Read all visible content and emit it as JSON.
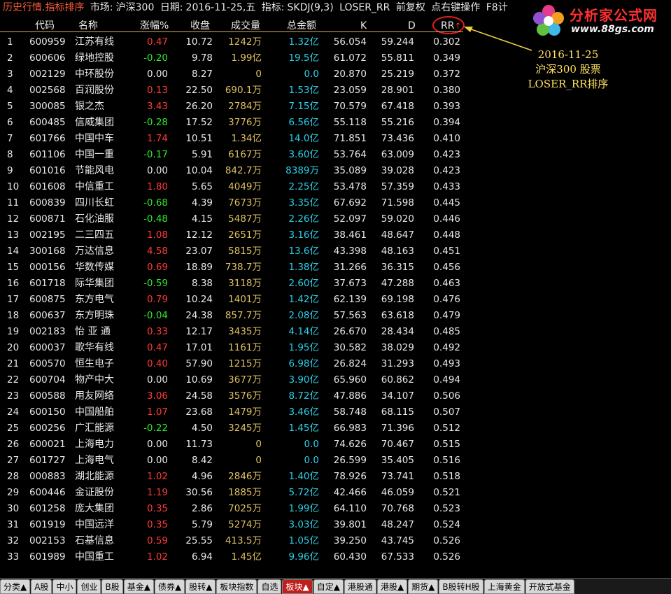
{
  "title": {
    "main": "历史行情.指标排序",
    "market_label": "市场:",
    "market": "沪深300",
    "date_label": "日期:",
    "date": "2016-11-25,五",
    "indicator_label": "指标:",
    "indicator": "SKDJ(9,3)",
    "sort_field": "LOSER_RR",
    "adjust": "前复权",
    "hint": "点右键操作",
    "f8": "F8计"
  },
  "logo": {
    "name": "分析家公式网",
    "url": "www.88gs.com"
  },
  "columns": {
    "code": "代码",
    "name": "名称",
    "pct": "涨幅%",
    "close": "收盘",
    "volume": "成交量",
    "amount": "总金额",
    "k": "K",
    "d": "D",
    "rr": "RR",
    "sort_arrow": "↑"
  },
  "annotation": {
    "line1": "2016-11-25",
    "line2": "沪深300 股票",
    "line3": "LOSER_RR排序"
  },
  "rows": [
    {
      "idx": "1",
      "code": "600959",
      "name": "江苏有线",
      "pct": "0.47",
      "dir": "up",
      "close": "10.72",
      "vol": "1242",
      "vol_u": "万",
      "amt": "1.32",
      "amt_u": "亿",
      "k": "56.054",
      "d": "59.244",
      "rr": "0.302"
    },
    {
      "idx": "2",
      "code": "600606",
      "name": "绿地控股",
      "pct": "-0.20",
      "dir": "down",
      "close": "9.78",
      "vol": "1.99",
      "vol_u": "亿",
      "amt": "19.5",
      "amt_u": "亿",
      "k": "61.072",
      "d": "55.811",
      "rr": "0.349"
    },
    {
      "idx": "3",
      "code": "002129",
      "name": "中环股份",
      "pct": "0.00",
      "dir": "flat",
      "close": "8.27",
      "vol": "0",
      "vol_u": "",
      "amt": "0.0",
      "amt_u": "",
      "k": "20.870",
      "d": "25.219",
      "rr": "0.372"
    },
    {
      "idx": "4",
      "code": "002568",
      "name": "百润股份",
      "pct": "0.13",
      "dir": "up",
      "close": "22.50",
      "vol": "690.1",
      "vol_u": "万",
      "amt": "1.53",
      "amt_u": "亿",
      "k": "23.059",
      "d": "28.901",
      "rr": "0.380"
    },
    {
      "idx": "5",
      "code": "300085",
      "name": "银之杰",
      "pct": "3.43",
      "dir": "up",
      "close": "26.20",
      "vol": "2784",
      "vol_u": "万",
      "amt": "7.15",
      "amt_u": "亿",
      "k": "70.579",
      "d": "67.418",
      "rr": "0.393"
    },
    {
      "idx": "6",
      "code": "600485",
      "name": "信威集团",
      "pct": "-0.28",
      "dir": "down",
      "close": "17.52",
      "vol": "3776",
      "vol_u": "万",
      "amt": "6.56",
      "amt_u": "亿",
      "k": "55.118",
      "d": "55.216",
      "rr": "0.394"
    },
    {
      "idx": "7",
      "code": "601766",
      "name": "中国中车",
      "pct": "1.74",
      "dir": "up",
      "close": "10.51",
      "vol": "1.34",
      "vol_u": "亿",
      "amt": "14.0",
      "amt_u": "亿",
      "k": "71.851",
      "d": "73.436",
      "rr": "0.410"
    },
    {
      "idx": "8",
      "code": "601106",
      "name": "中国一重",
      "pct": "-0.17",
      "dir": "down",
      "close": "5.91",
      "vol": "6167",
      "vol_u": "万",
      "amt": "3.60",
      "amt_u": "亿",
      "k": "53.764",
      "d": "63.009",
      "rr": "0.423"
    },
    {
      "idx": "9",
      "code": "601016",
      "name": "节能风电",
      "pct": "0.00",
      "dir": "flat",
      "close": "10.04",
      "vol": "842.7",
      "vol_u": "万",
      "amt": "8389",
      "amt_u": "万",
      "k": "35.089",
      "d": "39.028",
      "rr": "0.423"
    },
    {
      "idx": "10",
      "code": "601608",
      "name": "中信重工",
      "pct": "1.80",
      "dir": "up",
      "close": "5.65",
      "vol": "4049",
      "vol_u": "万",
      "amt": "2.25",
      "amt_u": "亿",
      "k": "53.478",
      "d": "57.359",
      "rr": "0.433"
    },
    {
      "idx": "11",
      "code": "600839",
      "name": "四川长虹",
      "pct": "-0.68",
      "dir": "down",
      "close": "4.39",
      "vol": "7673",
      "vol_u": "万",
      "amt": "3.35",
      "amt_u": "亿",
      "k": "67.692",
      "d": "71.598",
      "rr": "0.445"
    },
    {
      "idx": "12",
      "code": "600871",
      "name": "石化油服",
      "pct": "-0.48",
      "dir": "down",
      "close": "4.15",
      "vol": "5487",
      "vol_u": "万",
      "amt": "2.26",
      "amt_u": "亿",
      "k": "52.097",
      "d": "59.020",
      "rr": "0.446"
    },
    {
      "idx": "13",
      "code": "002195",
      "name": "二三四五",
      "pct": "1.08",
      "dir": "up",
      "close": "12.12",
      "vol": "2651",
      "vol_u": "万",
      "amt": "3.16",
      "amt_u": "亿",
      "k": "38.461",
      "d": "48.647",
      "rr": "0.448"
    },
    {
      "idx": "14",
      "code": "300168",
      "name": "万达信息",
      "pct": "4.58",
      "dir": "up",
      "close": "23.07",
      "vol": "5815",
      "vol_u": "万",
      "amt": "13.6",
      "amt_u": "亿",
      "k": "43.398",
      "d": "48.163",
      "rr": "0.451"
    },
    {
      "idx": "15",
      "code": "000156",
      "name": "华数传媒",
      "pct": "0.69",
      "dir": "up",
      "close": "18.89",
      "vol": "738.7",
      "vol_u": "万",
      "amt": "1.38",
      "amt_u": "亿",
      "k": "31.266",
      "d": "36.315",
      "rr": "0.456"
    },
    {
      "idx": "16",
      "code": "601718",
      "name": "际华集团",
      "pct": "-0.59",
      "dir": "down",
      "close": "8.38",
      "vol": "3118",
      "vol_u": "万",
      "amt": "2.60",
      "amt_u": "亿",
      "k": "37.673",
      "d": "47.288",
      "rr": "0.463"
    },
    {
      "idx": "17",
      "code": "600875",
      "name": "东方电气",
      "pct": "0.79",
      "dir": "up",
      "close": "10.24",
      "vol": "1401",
      "vol_u": "万",
      "amt": "1.42",
      "amt_u": "亿",
      "k": "62.139",
      "d": "69.198",
      "rr": "0.476"
    },
    {
      "idx": "18",
      "code": "600637",
      "name": "东方明珠",
      "pct": "-0.04",
      "dir": "down",
      "close": "24.38",
      "vol": "857.7",
      "vol_u": "万",
      "amt": "2.08",
      "amt_u": "亿",
      "k": "57.563",
      "d": "63.618",
      "rr": "0.479"
    },
    {
      "idx": "19",
      "code": "002183",
      "name": "怡 亚 通",
      "pct": "0.33",
      "dir": "up",
      "close": "12.17",
      "vol": "3435",
      "vol_u": "万",
      "amt": "4.14",
      "amt_u": "亿",
      "k": "26.670",
      "d": "28.434",
      "rr": "0.485"
    },
    {
      "idx": "20",
      "code": "600037",
      "name": "歌华有线",
      "pct": "0.47",
      "dir": "up",
      "close": "17.01",
      "vol": "1161",
      "vol_u": "万",
      "amt": "1.95",
      "amt_u": "亿",
      "k": "30.582",
      "d": "38.029",
      "rr": "0.492"
    },
    {
      "idx": "21",
      "code": "600570",
      "name": "恒生电子",
      "pct": "0.40",
      "dir": "up",
      "close": "57.90",
      "vol": "1215",
      "vol_u": "万",
      "amt": "6.98",
      "amt_u": "亿",
      "k": "26.824",
      "d": "31.293",
      "rr": "0.493"
    },
    {
      "idx": "22",
      "code": "600704",
      "name": "物产中大",
      "pct": "0.00",
      "dir": "flat",
      "close": "10.69",
      "vol": "3677",
      "vol_u": "万",
      "amt": "3.90",
      "amt_u": "亿",
      "k": "65.960",
      "d": "60.862",
      "rr": "0.494"
    },
    {
      "idx": "23",
      "code": "600588",
      "name": "用友网络",
      "pct": "3.06",
      "dir": "up",
      "close": "24.58",
      "vol": "3576",
      "vol_u": "万",
      "amt": "8.72",
      "amt_u": "亿",
      "k": "47.886",
      "d": "34.107",
      "rr": "0.506"
    },
    {
      "idx": "24",
      "code": "600150",
      "name": "中国船舶",
      "pct": "1.07",
      "dir": "up",
      "close": "23.68",
      "vol": "1479",
      "vol_u": "万",
      "amt": "3.46",
      "amt_u": "亿",
      "k": "58.748",
      "d": "68.115",
      "rr": "0.507"
    },
    {
      "idx": "25",
      "code": "600256",
      "name": "广汇能源",
      "pct": "-0.22",
      "dir": "down",
      "close": "4.50",
      "vol": "3245",
      "vol_u": "万",
      "amt": "1.45",
      "amt_u": "亿",
      "k": "66.983",
      "d": "71.396",
      "rr": "0.512"
    },
    {
      "idx": "26",
      "code": "600021",
      "name": "上海电力",
      "pct": "0.00",
      "dir": "flat",
      "close": "11.73",
      "vol": "0",
      "vol_u": "",
      "amt": "0.0",
      "amt_u": "",
      "k": "74.626",
      "d": "70.467",
      "rr": "0.515"
    },
    {
      "idx": "27",
      "code": "601727",
      "name": "上海电气",
      "pct": "0.00",
      "dir": "flat",
      "close": "8.42",
      "vol": "0",
      "vol_u": "",
      "amt": "0.0",
      "amt_u": "",
      "k": "26.599",
      "d": "35.405",
      "rr": "0.516"
    },
    {
      "idx": "28",
      "code": "000883",
      "name": "湖北能源",
      "pct": "1.02",
      "dir": "up",
      "close": "4.96",
      "vol": "2846",
      "vol_u": "万",
      "amt": "1.40",
      "amt_u": "亿",
      "k": "78.926",
      "d": "73.741",
      "rr": "0.518"
    },
    {
      "idx": "29",
      "code": "600446",
      "name": "金证股份",
      "pct": "1.19",
      "dir": "up",
      "close": "30.56",
      "vol": "1885",
      "vol_u": "万",
      "amt": "5.72",
      "amt_u": "亿",
      "k": "42.466",
      "d": "46.059",
      "rr": "0.521"
    },
    {
      "idx": "30",
      "code": "601258",
      "name": "庞大集团",
      "pct": "0.35",
      "dir": "up",
      "close": "2.86",
      "vol": "7025",
      "vol_u": "万",
      "amt": "1.99",
      "amt_u": "亿",
      "k": "64.110",
      "d": "70.768",
      "rr": "0.523"
    },
    {
      "idx": "31",
      "code": "601919",
      "name": "中国远洋",
      "pct": "0.35",
      "dir": "up",
      "close": "5.79",
      "vol": "5274",
      "vol_u": "万",
      "amt": "3.03",
      "amt_u": "亿",
      "k": "39.801",
      "d": "48.247",
      "rr": "0.524"
    },
    {
      "idx": "32",
      "code": "002153",
      "name": "石基信息",
      "pct": "0.59",
      "dir": "up",
      "close": "25.55",
      "vol": "413.5",
      "vol_u": "万",
      "amt": "1.05",
      "amt_u": "亿",
      "k": "39.250",
      "d": "43.745",
      "rr": "0.526"
    },
    {
      "idx": "33",
      "code": "601989",
      "name": "中国重工",
      "pct": "1.02",
      "dir": "up",
      "close": "6.94",
      "vol": "1.45",
      "vol_u": "亿",
      "amt": "9.96",
      "amt_u": "亿",
      "k": "60.430",
      "d": "67.533",
      "rr": "0.526"
    }
  ],
  "tabs": [
    {
      "label": "分类▲",
      "active": false
    },
    {
      "label": "A股",
      "active": false
    },
    {
      "label": "中小",
      "active": false
    },
    {
      "label": "创业",
      "active": false
    },
    {
      "label": "B股",
      "active": false
    },
    {
      "label": "基金▲",
      "active": false
    },
    {
      "label": "债券▲",
      "active": false
    },
    {
      "label": "股转▲",
      "active": false
    },
    {
      "label": "板块指数",
      "active": false
    },
    {
      "label": "自选",
      "active": false
    },
    {
      "label": "板块▲",
      "active": true
    },
    {
      "label": "自定▲",
      "active": false
    },
    {
      "label": "港股通",
      "active": false
    },
    {
      "label": "港股▲",
      "active": false
    },
    {
      "label": "期货▲",
      "active": false
    },
    {
      "label": "B股转H股",
      "active": false
    },
    {
      "label": "上海黄金",
      "active": false
    },
    {
      "label": "开放式基金",
      "active": false
    }
  ]
}
